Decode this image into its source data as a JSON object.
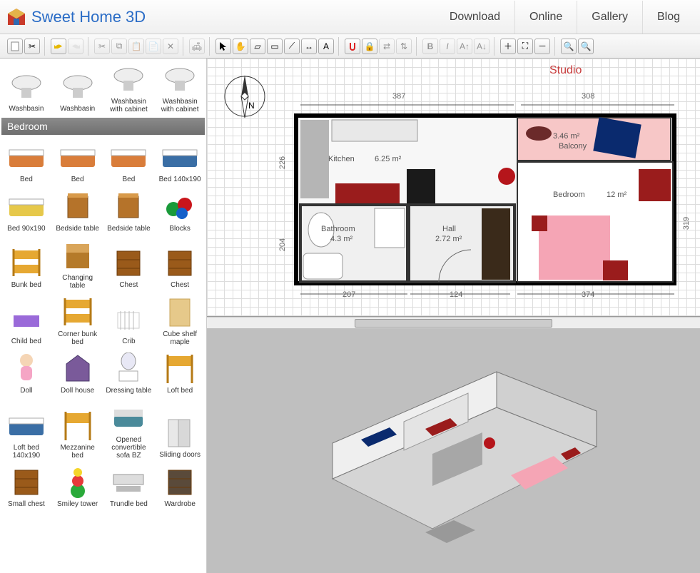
{
  "app": {
    "title": "Sweet Home 3D"
  },
  "nav": {
    "download": "Download",
    "online": "Online",
    "gallery": "Gallery",
    "blog": "Blog"
  },
  "catalog": {
    "top_row": [
      {
        "label": "Washbasin"
      },
      {
        "label": "Washbasin"
      },
      {
        "label": "Washbasin with cabinet"
      },
      {
        "label": "Washbasin with cabinet"
      }
    ],
    "category_header": "Bedroom",
    "items": [
      "Bed",
      "Bed",
      "Bed",
      "Bed 140x190",
      "Bed 90x190",
      "Bedside table",
      "Bedside table",
      "Blocks",
      "Bunk bed",
      "Changing table",
      "Chest",
      "Chest",
      "Child bed",
      "Corner bunk bed",
      "Crib",
      "Cube shelf maple",
      "Doll",
      "Doll house",
      "Dressing table",
      "Loft bed",
      "Loft bed 140x190",
      "Mezzanine bed",
      "Opened convertible sofa BZ",
      "Sliding doors",
      "Small chest",
      "Smiley tower",
      "Trundle bed",
      "Wardrobe"
    ]
  },
  "plan": {
    "title": "Studio",
    "compass_label": "N",
    "dims": {
      "top1": "387",
      "top2": "308",
      "left1": "226",
      "left2": "204",
      "right": "319",
      "bot1": "207",
      "bot2": "124",
      "bot3": "374"
    },
    "rooms": {
      "kitchen": {
        "name": "Kitchen",
        "area": "6.25 m²"
      },
      "balcony": {
        "name": "Balcony",
        "area": "3.46 m²"
      },
      "bedroom": {
        "name": "Bedroom",
        "area": "12 m²"
      },
      "bathroom": {
        "name": "Bathroom",
        "area": "4.3 m²"
      },
      "hall": {
        "name": "Hall",
        "area": "2.72 m²"
      }
    }
  }
}
